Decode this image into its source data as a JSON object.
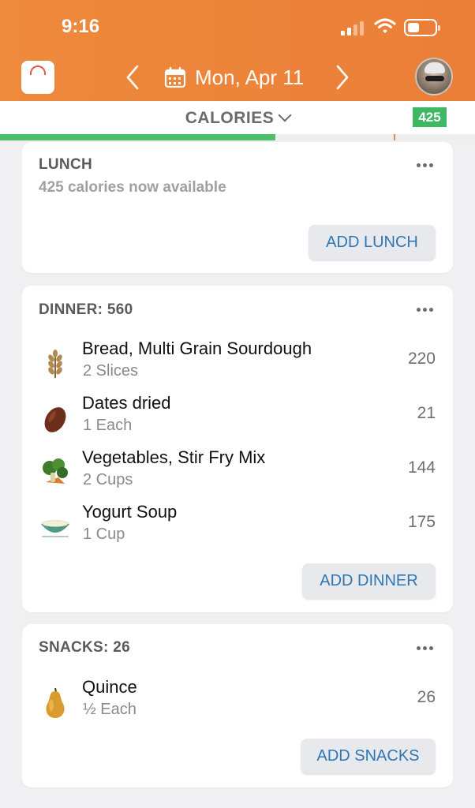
{
  "status_bar": {
    "time": "9:16"
  },
  "header": {
    "date": "Mon, Apr 11",
    "icons": [
      "scale-icon",
      "chevron-left-icon",
      "calendar-icon",
      "chevron-right-icon",
      "avatar"
    ],
    "background_color": "#ee8a3c"
  },
  "calorie_bar": {
    "label": "CALORIES",
    "badge": "425",
    "badge_color": "#3fb864",
    "consumed_fraction": 0.58
  },
  "lunch": {
    "title": "LUNCH",
    "subtitle": "425 calories now available",
    "add_label": "ADD LUNCH"
  },
  "dinner": {
    "title": "DINNER: 560",
    "add_label": "ADD DINNER",
    "items": [
      {
        "name": "Bread, Multi Grain Sourdough",
        "serving": "2 Slices",
        "calories": "220",
        "icon": "wheat-icon"
      },
      {
        "name": "Dates dried",
        "serving": "1 Each",
        "calories": "21",
        "icon": "date-fruit-icon"
      },
      {
        "name": "Vegetables, Stir Fry Mix",
        "serving": "2 Cups",
        "calories": "144",
        "icon": "vegetables-icon"
      },
      {
        "name": "Yogurt Soup",
        "serving": "1 Cup",
        "calories": "175",
        "icon": "soup-bowl-icon"
      }
    ]
  },
  "snacks": {
    "title": "SNACKS: 26",
    "add_label": "ADD SNACKS",
    "items": [
      {
        "name": "Quince",
        "serving": "½ Each",
        "calories": "26",
        "icon": "quince-icon"
      }
    ]
  },
  "colors": {
    "accent_blue": "#2f76b5",
    "progress_green": "#4cbf6a"
  }
}
